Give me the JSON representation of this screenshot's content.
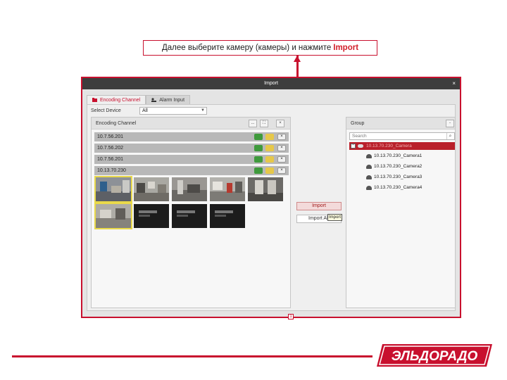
{
  "callout": {
    "text": "Далее выберите камеру (камеры) и нажмите",
    "highlight": "Import"
  },
  "dialog": {
    "title": "Import",
    "close": "×",
    "tabs": [
      {
        "label": "Encoding Channel"
      },
      {
        "label": "Alarm Input"
      }
    ],
    "select_device": {
      "label": "Select Device",
      "value": "All"
    },
    "left_panel": {
      "title": "Encoding Channel",
      "buttons": [
        "...",
        "⛶",
        "×"
      ],
      "rows": [
        {
          "ip": "10.7.56.201"
        },
        {
          "ip": "10.7.56.202"
        },
        {
          "ip": "10.7.56.201"
        },
        {
          "ip": "10.13.70.230"
        }
      ],
      "page": "1"
    },
    "actions": {
      "import": "Import",
      "import_all": "Import All",
      "tooltip": "Import"
    },
    "right_panel": {
      "title": "Group",
      "collapse": "-",
      "search_placeholder": "Search",
      "root": "10.13.70.230_Camera",
      "cameras": [
        "10.13.70.230_Camera1",
        "10.13.70.230_Camera2",
        "10.13.70.230_Camera3",
        "10.13.70.230_Camera4"
      ]
    }
  },
  "brand": {
    "logo_text": "ЭЛЬДОРАДО",
    "color": "#c8102e"
  }
}
